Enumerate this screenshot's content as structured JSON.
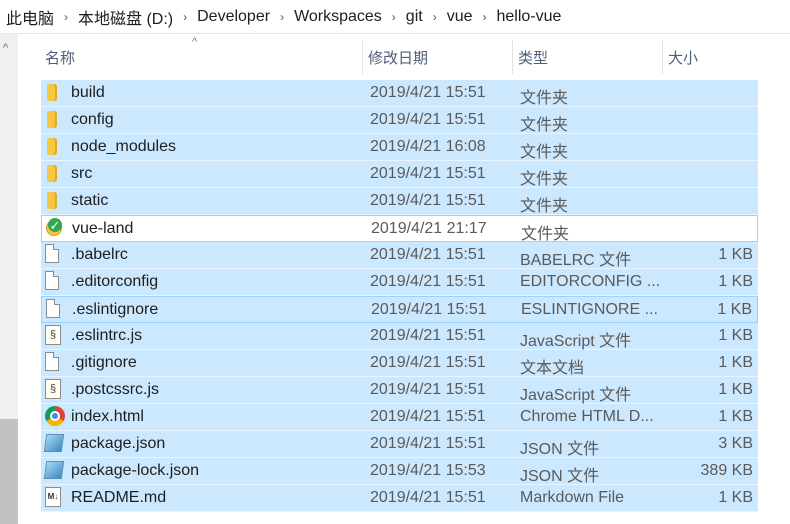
{
  "breadcrumb": [
    "此电脑",
    "本地磁盘 (D:)",
    "Developer",
    "Workspaces",
    "git",
    "vue",
    "hello-vue"
  ],
  "breadcrumb_separator": "›",
  "columns": {
    "name": "名称",
    "date": "修改日期",
    "type": "类型",
    "size": "大小"
  },
  "sort_indicator": "^",
  "scroll_up_arrow": "^",
  "files": [
    {
      "name": "build",
      "date": "2019/4/21 15:51",
      "type": "文件夹",
      "size": "",
      "icon": "folder-icon"
    },
    {
      "name": "config",
      "date": "2019/4/21 15:51",
      "type": "文件夹",
      "size": "",
      "icon": "folder-icon"
    },
    {
      "name": "node_modules",
      "date": "2019/4/21 16:08",
      "type": "文件夹",
      "size": "",
      "icon": "folder-icon"
    },
    {
      "name": "src",
      "date": "2019/4/21 15:51",
      "type": "文件夹",
      "size": "",
      "icon": "folder-icon"
    },
    {
      "name": "static",
      "date": "2019/4/21 15:51",
      "type": "文件夹",
      "size": "",
      "icon": "folder-icon"
    },
    {
      "name": "vue-land",
      "date": "2019/4/21 21:17",
      "type": "文件夹",
      "size": "",
      "icon": "synced-folder-icon"
    },
    {
      "name": ".babelrc",
      "date": "2019/4/21 15:51",
      "type": "BABELRC 文件",
      "size": "1 KB",
      "icon": "file-icon"
    },
    {
      "name": ".editorconfig",
      "date": "2019/4/21 15:51",
      "type": "EDITORCONFIG ...",
      "size": "1 KB",
      "icon": "file-icon"
    },
    {
      "name": ".eslintignore",
      "date": "2019/4/21 15:51",
      "type": "ESLINTIGNORE ...",
      "size": "1 KB",
      "icon": "file-icon"
    },
    {
      "name": ".eslintrc.js",
      "date": "2019/4/21 15:51",
      "type": "JavaScript 文件",
      "size": "1 KB",
      "icon": "js-file-icon"
    },
    {
      "name": ".gitignore",
      "date": "2019/4/21 15:51",
      "type": "文本文档",
      "size": "1 KB",
      "icon": "file-icon"
    },
    {
      "name": ".postcssrc.js",
      "date": "2019/4/21 15:51",
      "type": "JavaScript 文件",
      "size": "1 KB",
      "icon": "js-file-icon"
    },
    {
      "name": "index.html",
      "date": "2019/4/21 15:51",
      "type": "Chrome HTML D...",
      "size": "1 KB",
      "icon": "chrome-icon"
    },
    {
      "name": "package.json",
      "date": "2019/4/21 15:51",
      "type": "JSON 文件",
      "size": "3 KB",
      "icon": "json-file-icon"
    },
    {
      "name": "package-lock.json",
      "date": "2019/4/21 15:53",
      "type": "JSON 文件",
      "size": "389 KB",
      "icon": "json-file-icon"
    },
    {
      "name": "README.md",
      "date": "2019/4/21 15:51",
      "type": "Markdown File",
      "size": "1 KB",
      "icon": "markdown-file-icon"
    }
  ],
  "colors": {
    "selection": "#cce8ff",
    "selection_border": "#99d1ff",
    "header_text": "#4c607a"
  }
}
